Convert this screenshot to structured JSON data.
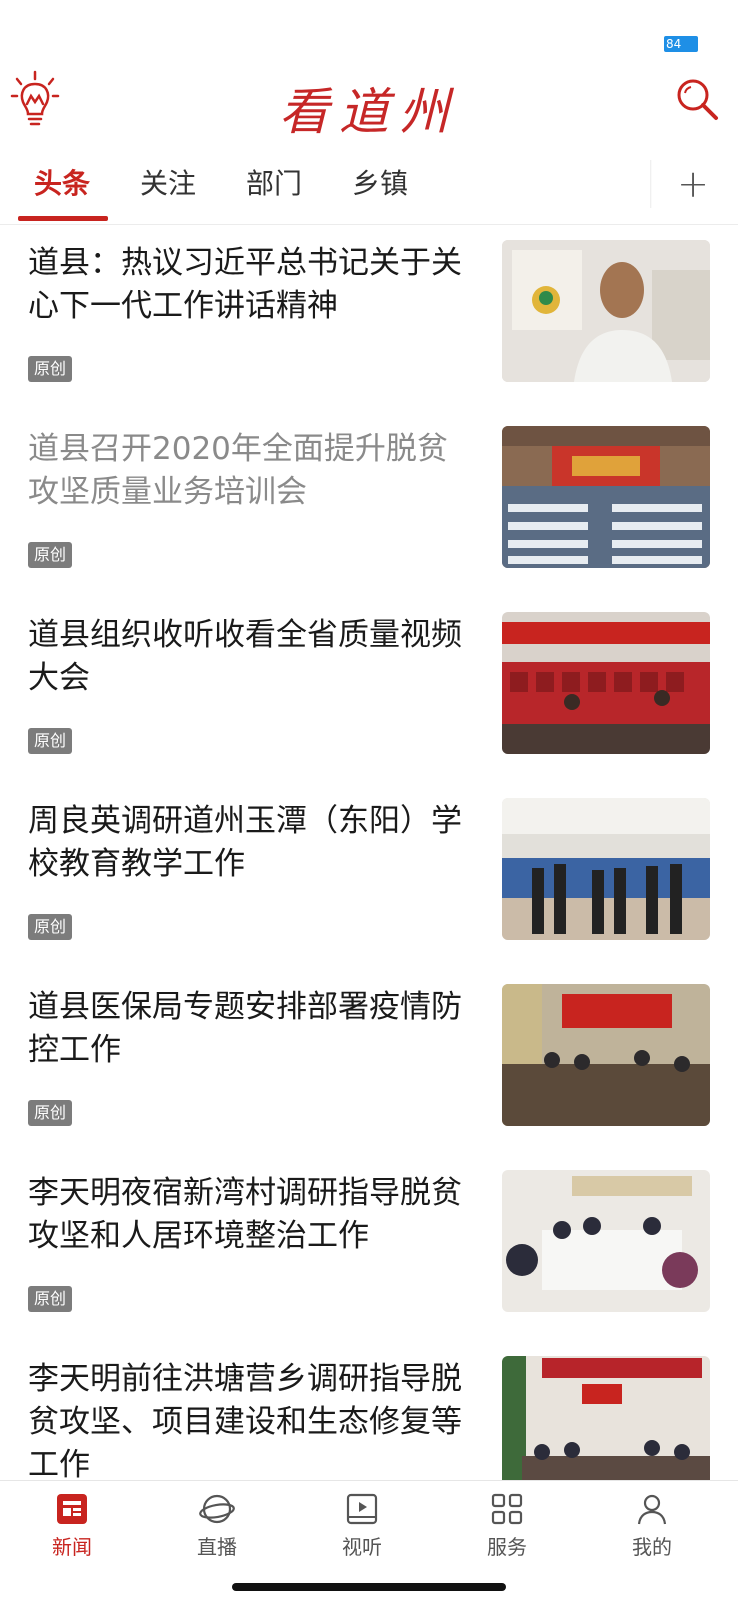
{
  "status_bar": {
    "battery": "84"
  },
  "header": {
    "title": "看道州",
    "left_icon": "lightbulb-icon",
    "right_icon": "search-icon"
  },
  "tabs": [
    {
      "label": "头条",
      "active": true
    },
    {
      "label": "关注",
      "active": false
    },
    {
      "label": "部门",
      "active": false
    },
    {
      "label": "乡镇",
      "active": false
    }
  ],
  "add_tab_label": "+",
  "feed": [
    {
      "title": "道县：热议习近平总书记关于关心下一代工作讲话精神",
      "badge": "原创",
      "read": false
    },
    {
      "title": "道县召开2020年全面提升脱贫攻坚质量业务培训会",
      "badge": "原创",
      "read": true
    },
    {
      "title": "道县组织收听收看全省质量视频大会",
      "badge": "原创",
      "read": false
    },
    {
      "title": "周良英调研道州玉潭（东阳）学校教育教学工作",
      "badge": "原创",
      "read": false
    },
    {
      "title": "道县医保局专题安排部署疫情防控工作",
      "badge": "原创",
      "read": false
    },
    {
      "title": "李天明夜宿新湾村调研指导脱贫攻坚和人居环境整治工作",
      "badge": "原创",
      "read": false
    },
    {
      "title": "李天明前往洪塘营乡调研指导脱贫攻坚、项目建设和生态修复等工作",
      "badge": "",
      "read": false
    }
  ],
  "bottom_nav": [
    {
      "label": "新闻",
      "icon": "news-icon",
      "active": true
    },
    {
      "label": "直播",
      "icon": "live-icon",
      "active": false
    },
    {
      "label": "视听",
      "icon": "video-icon",
      "active": false
    },
    {
      "label": "服务",
      "icon": "services-icon",
      "active": false
    },
    {
      "label": "我的",
      "icon": "profile-icon",
      "active": false
    }
  ],
  "colors": {
    "accent": "#c8241f",
    "badge": "#7c7c7c"
  }
}
